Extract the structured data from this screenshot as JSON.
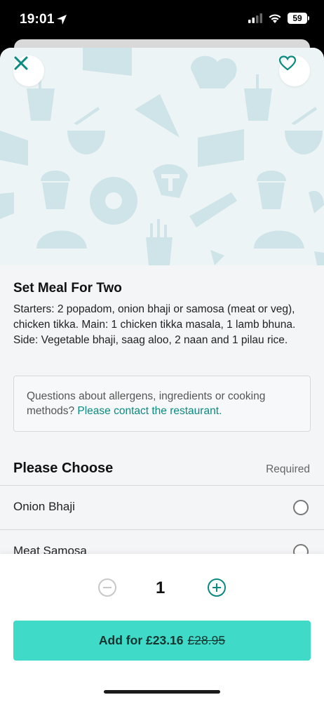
{
  "status": {
    "time": "19:01",
    "battery": "59",
    "icons": [
      "location-arrow-icon",
      "signal-icon",
      "wifi-icon",
      "battery-icon"
    ]
  },
  "header": {
    "close_icon": "close-icon",
    "favourite_icon": "heart-icon"
  },
  "item": {
    "title": "Set Meal For Two",
    "description": "Starters: 2 popadom, onion bhaji or samosa (meat or veg), chicken tikka. Main: 1 chicken tikka masala, 1 lamb bhuna. Side: Vegetable bhaji, saag aloo, 2 naan and 1 pilau rice."
  },
  "allergen": {
    "text": "Questions about allergens, ingredients or cooking methods?",
    "link": "Please contact the restaurant."
  },
  "choice": {
    "title": "Please Choose",
    "required": "Required",
    "options": [
      "Onion Bhaji",
      "Meat Samosa"
    ]
  },
  "order": {
    "quantity": "1",
    "add_label": "Add for £23.16",
    "old_price": "£28.95"
  },
  "colors": {
    "accent": "#40dac8",
    "teal_dark": "#0a8a80",
    "hero_bg": "#ecf4f6",
    "hero_shapes": "#cfe4e8"
  }
}
